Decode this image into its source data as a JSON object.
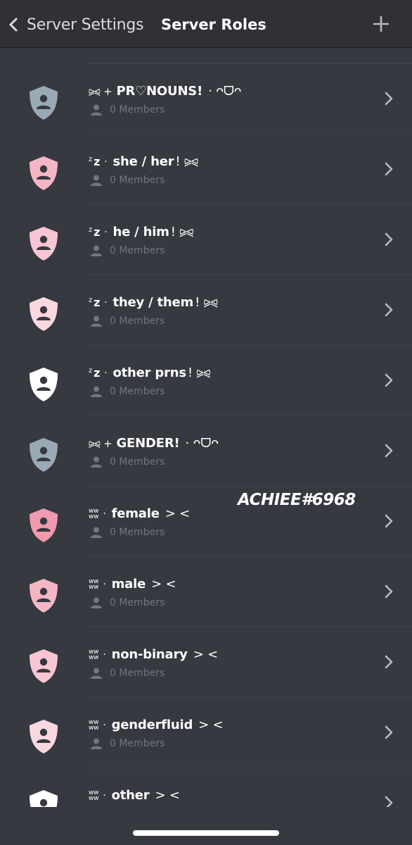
{
  "header": {
    "back_label": "Server Settings",
    "title": "Server Roles",
    "add_icon": "plus-icon"
  },
  "colors": {
    "background": "#36393f",
    "header_bg": "#2f3136",
    "separator": "#40444b",
    "muted_text": "#72767d",
    "chevron": "#b9bbbe"
  },
  "roles": [
    {
      "prefix": "⪩⪨ +",
      "name": "PR♡NOUNS!",
      "suffix": "·  ᴖᗜᴖ",
      "prefix_style": "bow",
      "members": "0 Members",
      "color": "#99aab5"
    },
    {
      "prefix": "z",
      "name": "she / her",
      "suffix": "!  ⪩⪨",
      "prefix_style": "zz",
      "members": "0 Members",
      "color": "#f4b6c5"
    },
    {
      "prefix": "z",
      "name": "he / him",
      "suffix": "!  ⪩⪨",
      "prefix_style": "zz",
      "members": "0 Members",
      "color": "#f7c6d2"
    },
    {
      "prefix": "z",
      "name": "they / them",
      "suffix": "!  ⪩⪨",
      "prefix_style": "zz",
      "members": "0 Members",
      "color": "#f9d8e0"
    },
    {
      "prefix": "z",
      "name": "other prns",
      "suffix": "!  ⪩⪨",
      "prefix_style": "zz",
      "members": "0 Members",
      "color": "#ffffff"
    },
    {
      "prefix": "⪩⪨ +",
      "name": "GENDER!",
      "suffix": "·  ᴖᗜᴖ",
      "prefix_style": "bow",
      "members": "0 Members",
      "color": "#99aab5"
    },
    {
      "prefix": "ww",
      "name": "female",
      "suffix": "> <",
      "prefix_style": "ww",
      "members": "0 Members",
      "color": "#ef9aae"
    },
    {
      "prefix": "ww",
      "name": "male",
      "suffix": "> <",
      "prefix_style": "ww",
      "members": "0 Members",
      "color": "#f4b6c5"
    },
    {
      "prefix": "ww",
      "name": "non-binary",
      "suffix": "> <",
      "prefix_style": "ww",
      "members": "0 Members",
      "color": "#f7c6d2"
    },
    {
      "prefix": "ww",
      "name": "genderfluid",
      "suffix": "> <",
      "prefix_style": "ww",
      "members": "0 Members",
      "color": "#f9d8e0"
    },
    {
      "prefix": "ww",
      "name": "other",
      "suffix": "> <",
      "prefix_style": "ww",
      "members": "",
      "color": "#ffffff"
    }
  ],
  "watermark": "ACHIEE#6968"
}
